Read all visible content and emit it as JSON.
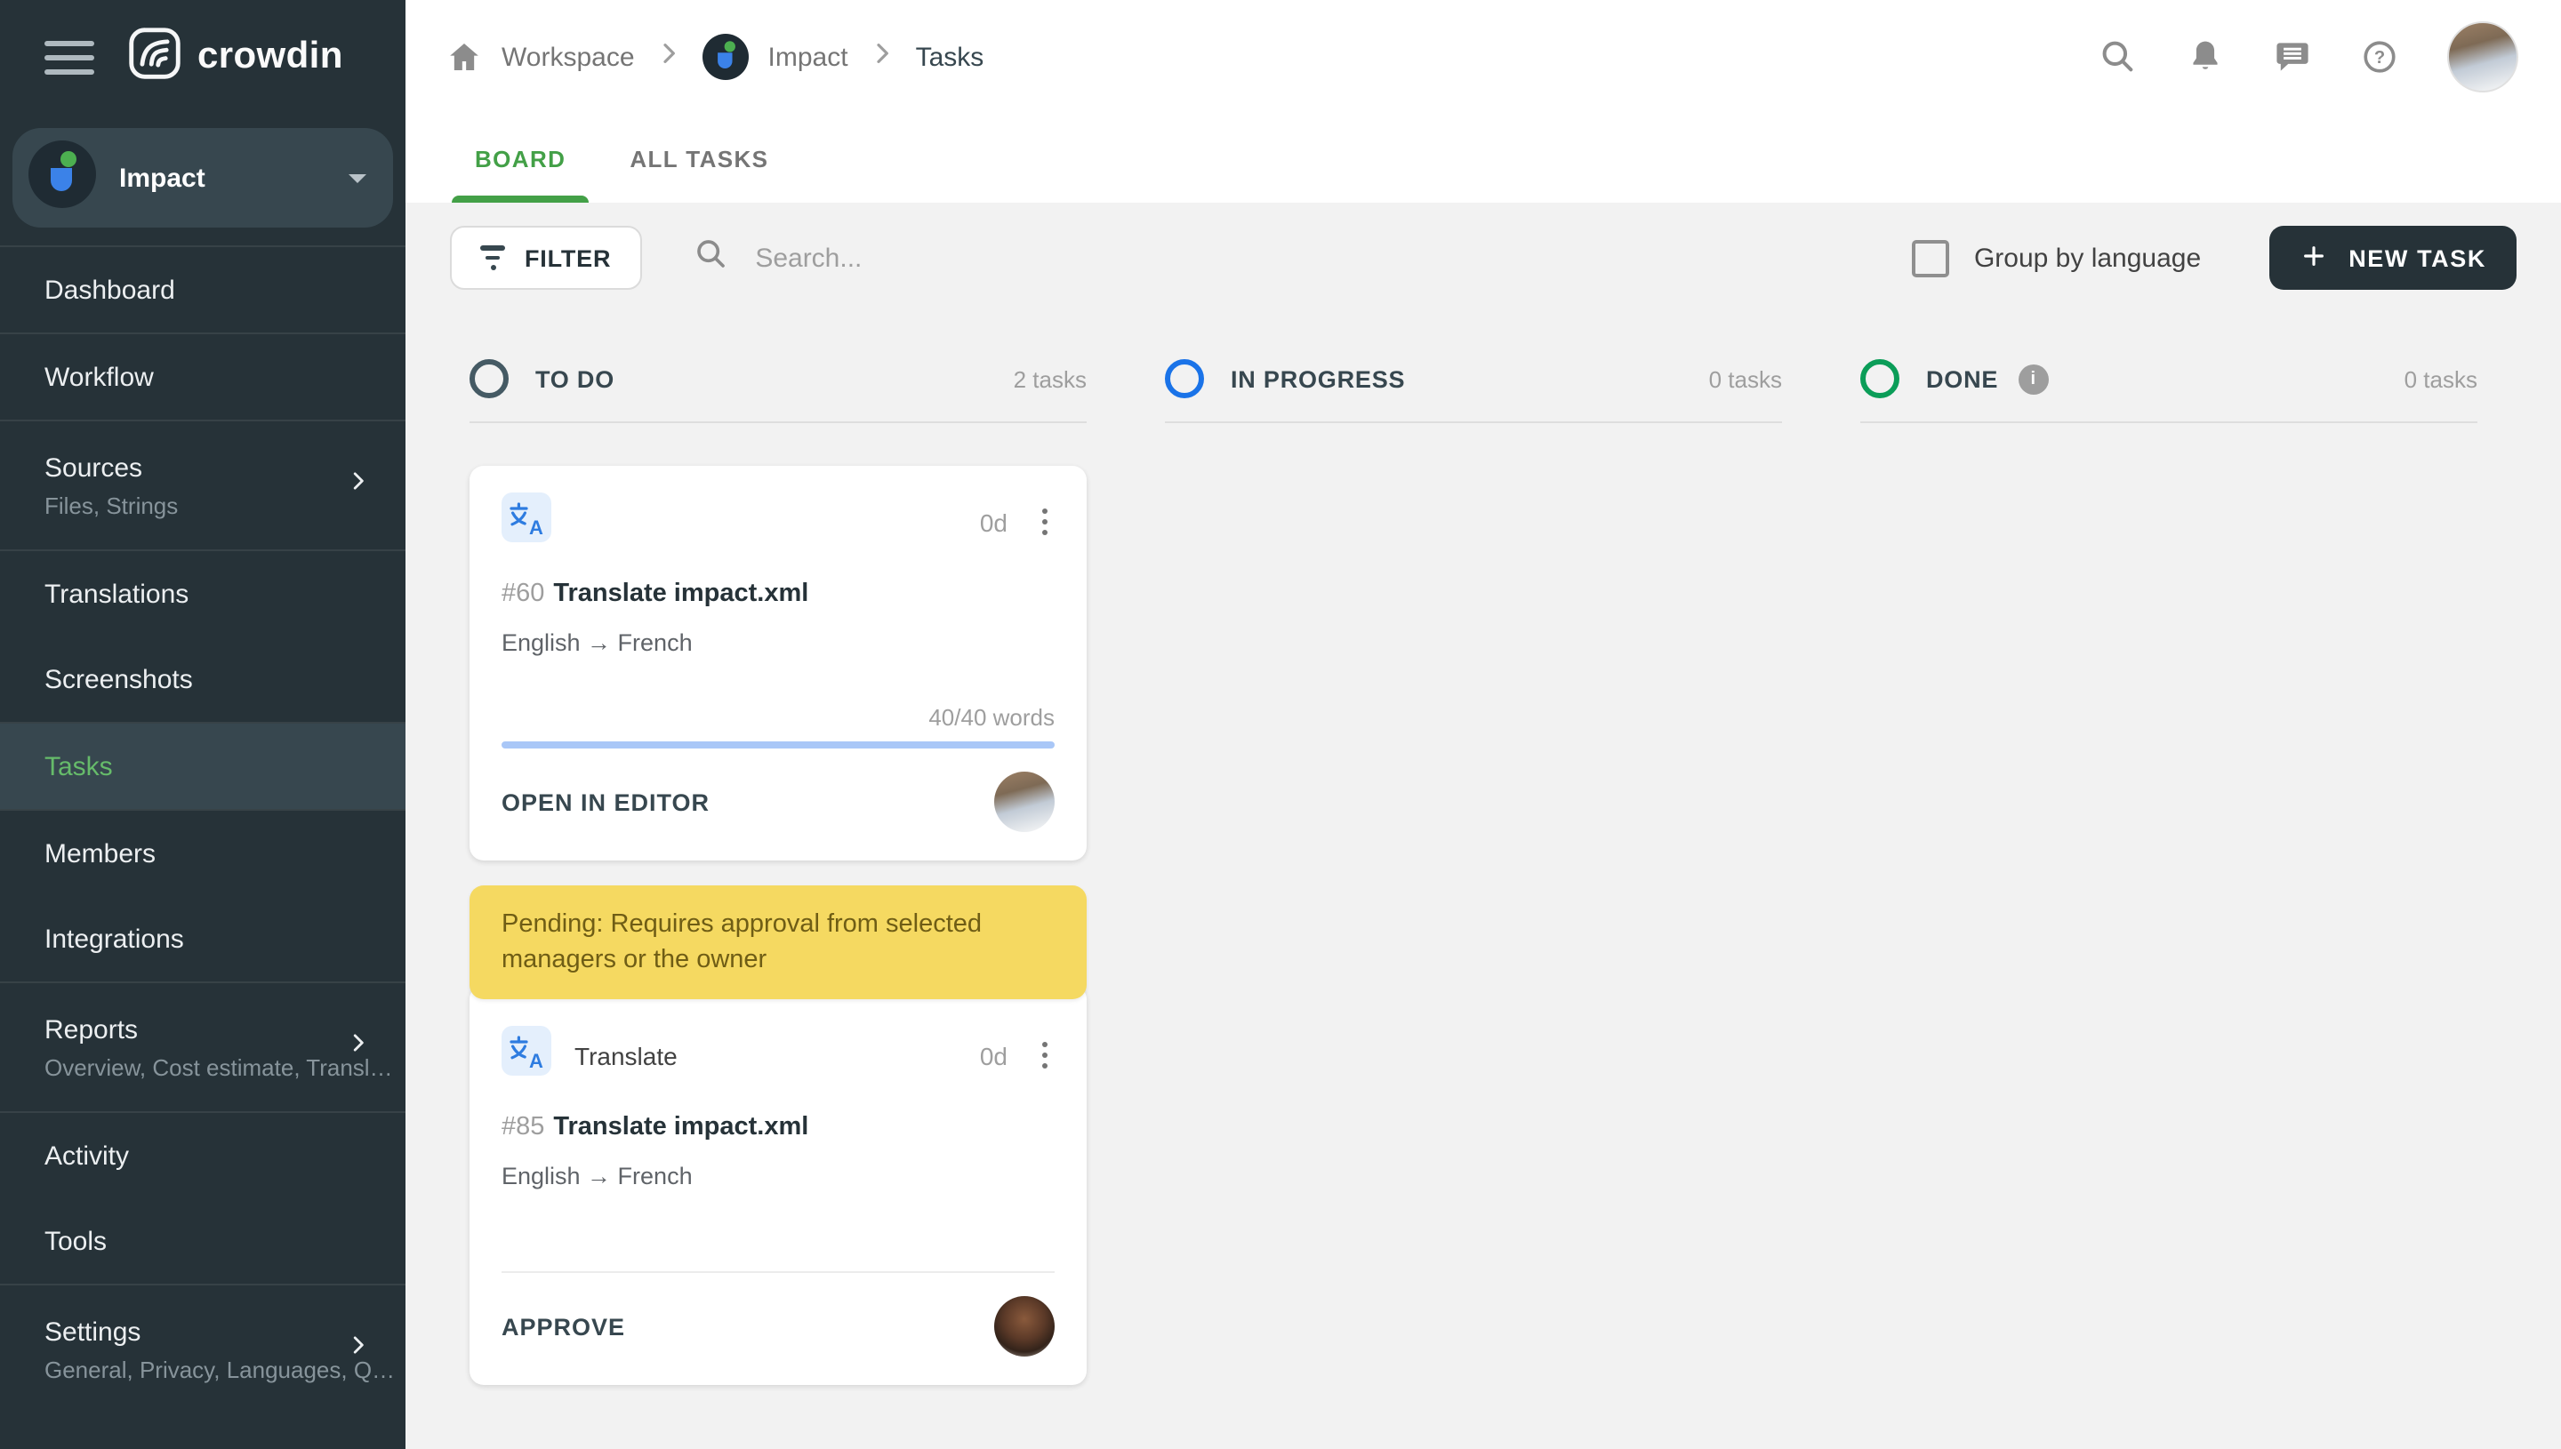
{
  "colors": {
    "sidebar_bg": "#263238",
    "sidebar_active_bg": "#37474F",
    "accent_green": "#43A047",
    "nav_active_green": "#66BB6A",
    "pending_banner_bg": "#F5D961",
    "pending_banner_text": "#6F5D15",
    "progress_bar": "#A9C7F7",
    "new_task_bg": "#263238"
  },
  "sidebar": {
    "brand": "crowdin",
    "project": {
      "name": "Impact"
    },
    "items": [
      {
        "label": "Dashboard"
      },
      {
        "label": "Workflow"
      },
      {
        "label": "Sources",
        "sublabel": "Files, Strings"
      },
      {
        "label": "Translations"
      },
      {
        "label": "Screenshots"
      },
      {
        "label": "Tasks"
      },
      {
        "label": "Members"
      },
      {
        "label": "Integrations"
      },
      {
        "label": "Reports",
        "sublabel": "Overview, Cost estimate, Transl…"
      },
      {
        "label": "Activity"
      },
      {
        "label": "Tools"
      },
      {
        "label": "Settings",
        "sublabel": "General, Privacy, Languages, Q…"
      }
    ]
  },
  "header": {
    "breadcrumb": {
      "workspace": "Workspace",
      "project": "Impact",
      "current": "Tasks"
    }
  },
  "tabs": {
    "board": "BOARD",
    "all_tasks": "ALL TASKS"
  },
  "toolbar": {
    "filter_label": "FILTER",
    "search_placeholder": "Search...",
    "group_by_language_label": "Group by language",
    "new_task_label": "NEW TASK"
  },
  "board": {
    "columns": [
      {
        "title": "TO DO",
        "count": "2 tasks",
        "color": "#455A64"
      },
      {
        "title": "IN PROGRESS",
        "count": "0 tasks",
        "color": "#1A73E8"
      },
      {
        "title": "DONE",
        "count": "0 tasks",
        "color": "#0B9D58",
        "info": "i"
      }
    ]
  },
  "cards": {
    "task60": {
      "duration": "0d",
      "id": "#60",
      "title": "Translate impact.xml",
      "languages": "English → French",
      "words": "40/40 words",
      "progress_width": "100%",
      "action": "OPEN IN EDITOR"
    },
    "task85": {
      "banner": "Pending: Requires approval from selected managers or the owner",
      "type": "Translate",
      "duration": "0d",
      "id": "#85",
      "title": "Translate impact.xml",
      "languages": "English → French",
      "action": "APPROVE"
    }
  }
}
